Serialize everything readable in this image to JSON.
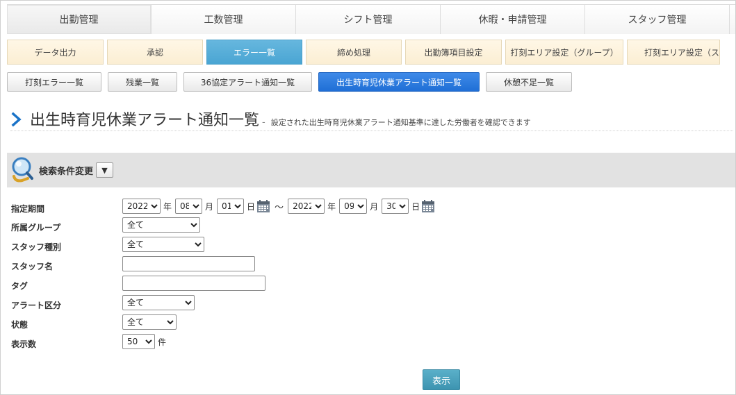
{
  "top_tabs": [
    "出勤管理",
    "工数管理",
    "シフト管理",
    "休暇・申請管理",
    "スタッフ管理"
  ],
  "sub_tabs": [
    "データ出力",
    "承認",
    "エラー一覧",
    "締め処理",
    "出勤簿項目設定",
    "打刻エリア設定（グループ）",
    "打刻エリア設定（ス"
  ],
  "sub_tabs_active": "エラー一覧",
  "error_buttons": [
    "打刻エラー一覧",
    "残業一覧",
    "36協定アラート通知一覧",
    "出生時育児休業アラート通知一覧",
    "休憩不足一覧"
  ],
  "page": {
    "title": "出生時育児休業アラート通知一覧",
    "separator": "-",
    "description": "設定された出生時育児休業アラート通知基準に達した労働者を確認できます"
  },
  "search": {
    "label": "検索条件変更",
    "toggle": "▼"
  },
  "form": {
    "period_label": "指定期間",
    "from_year": "2022",
    "from_month": "08",
    "from_day": "01",
    "to_year": "2022",
    "to_month": "09",
    "to_day": "30",
    "unit_year": "年",
    "unit_month": "月",
    "unit_day": "日",
    "tilde": "～",
    "group_label": "所属グループ",
    "group_value": "全て",
    "staff_type_label": "スタッフ種別",
    "staff_type_value": "全て",
    "staff_name_label": "スタッフ名",
    "staff_name_value": "",
    "tag_label": "タグ",
    "tag_value": "",
    "alert_type_label": "アラート区分",
    "alert_type_value": "全て",
    "status_label": "状態",
    "status_value": "全て",
    "count_label": "表示数",
    "count_value": "50",
    "count_unit": "件"
  },
  "submit_label": "表示",
  "colors": {
    "sub_tab_active": "#4aa5d3",
    "button_active": "#1f6fd6",
    "submit": "#3d94b0",
    "heading_chevron": "#1a73c8"
  }
}
